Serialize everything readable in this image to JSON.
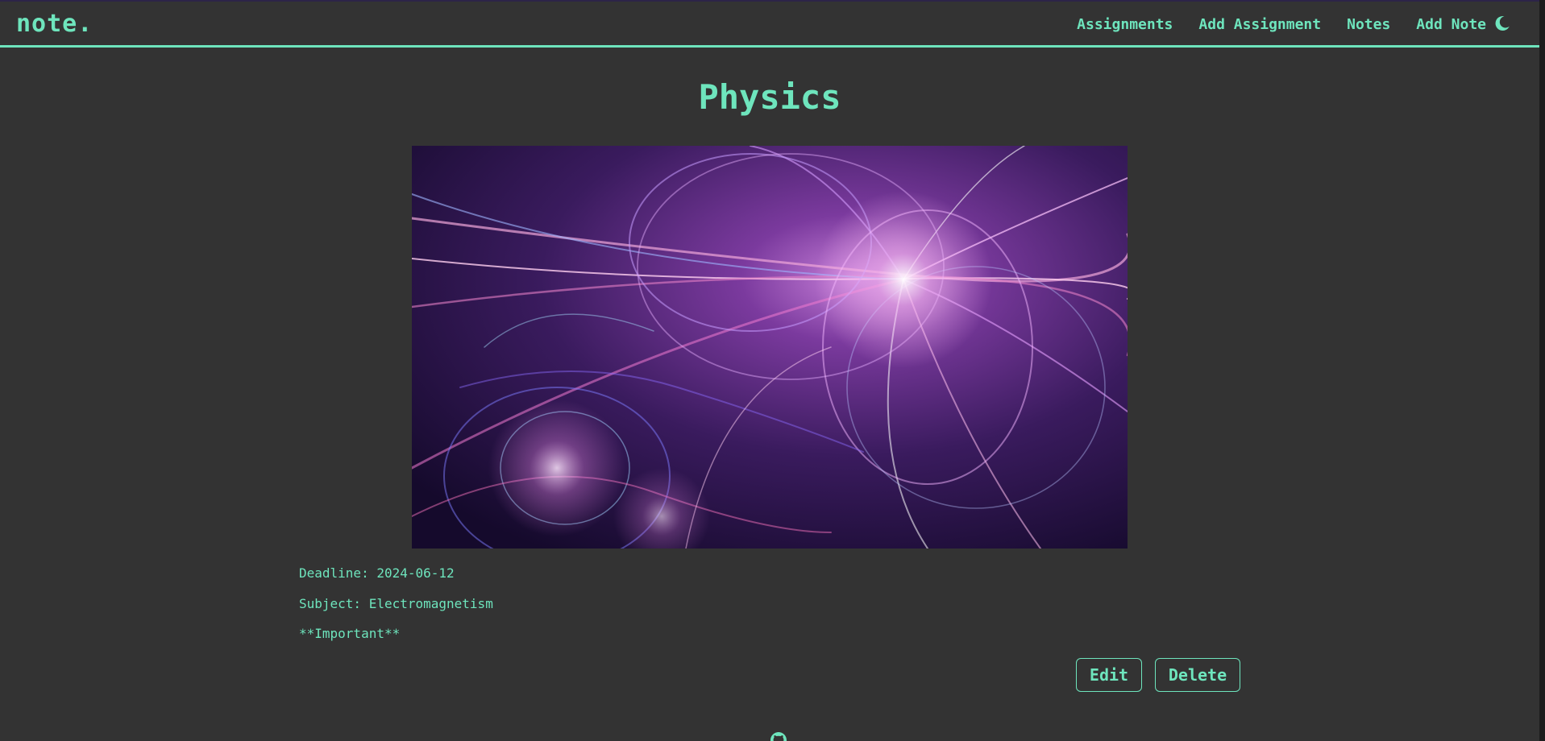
{
  "navbar": {
    "brand": "note.",
    "links": [
      "Assignments",
      "Add Assignment",
      "Notes",
      "Add Note"
    ],
    "theme_icon": "moon-icon"
  },
  "assignment": {
    "title": "Physics",
    "image_description_icon": "assignment-image",
    "deadline": "Deadline: 2024-06-12",
    "subject": "Subject: Electromagnetism",
    "note": "**Important**"
  },
  "actions": {
    "edit_label": "Edit",
    "delete_label": "Delete"
  },
  "footer": {
    "icon": "github-icon"
  },
  "colors": {
    "accent": "#6ee5bd",
    "background": "#333333"
  }
}
